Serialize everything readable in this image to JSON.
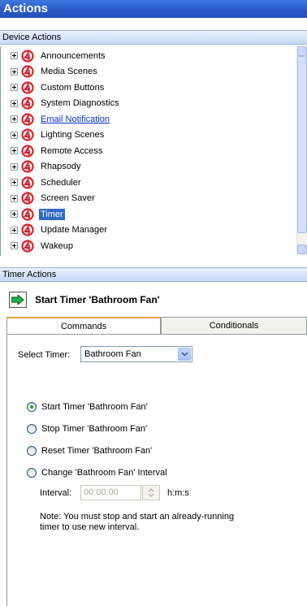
{
  "window": {
    "title": "Actions"
  },
  "device_actions": {
    "header": "Device Actions",
    "items": [
      {
        "label": "Announcements",
        "style": "normal"
      },
      {
        "label": "Media Scenes",
        "style": "normal"
      },
      {
        "label": "Custom Buttons",
        "style": "normal"
      },
      {
        "label": "System Diagnostics",
        "style": "normal"
      },
      {
        "label": "Email Notification",
        "style": "link"
      },
      {
        "label": "Lighting Scenes",
        "style": "normal"
      },
      {
        "label": "Remote Access",
        "style": "normal"
      },
      {
        "label": "Rhapsody",
        "style": "normal"
      },
      {
        "label": "Scheduler",
        "style": "normal"
      },
      {
        "label": "Screen Saver",
        "style": "normal"
      },
      {
        "label": "Timer",
        "style": "selected"
      },
      {
        "label": "Update Manager",
        "style": "normal"
      },
      {
        "label": "Wakeup",
        "style": "normal"
      }
    ]
  },
  "timer_actions": {
    "header": "Timer Actions",
    "action_title": "Start Timer 'Bathroom Fan'"
  },
  "tabs": {
    "commands": "Commands",
    "conditionals": "Conditionals"
  },
  "commands": {
    "select_timer_label": "Select Timer:",
    "select_timer_value": "Bathroom Fan",
    "radio_options": [
      {
        "label": "Start Timer 'Bathroom Fan'",
        "checked": true
      },
      {
        "label": "Stop Timer 'Bathroom Fan'",
        "checked": false
      },
      {
        "label": "Reset Timer 'Bathroom Fan'",
        "checked": false
      },
      {
        "label": "Change 'Bathroom Fan' Interval",
        "checked": false
      }
    ],
    "interval_label": "Interval:",
    "interval_value": "00:00:00",
    "interval_units": "h:m:s",
    "note": "Note: You must stop and start an already-running timer to use new interval."
  },
  "colors": {
    "title_bar": "#2a59c6",
    "selection": "#316ac5",
    "icon_red": "#d8232a",
    "arrow_green": "#22b14c"
  }
}
